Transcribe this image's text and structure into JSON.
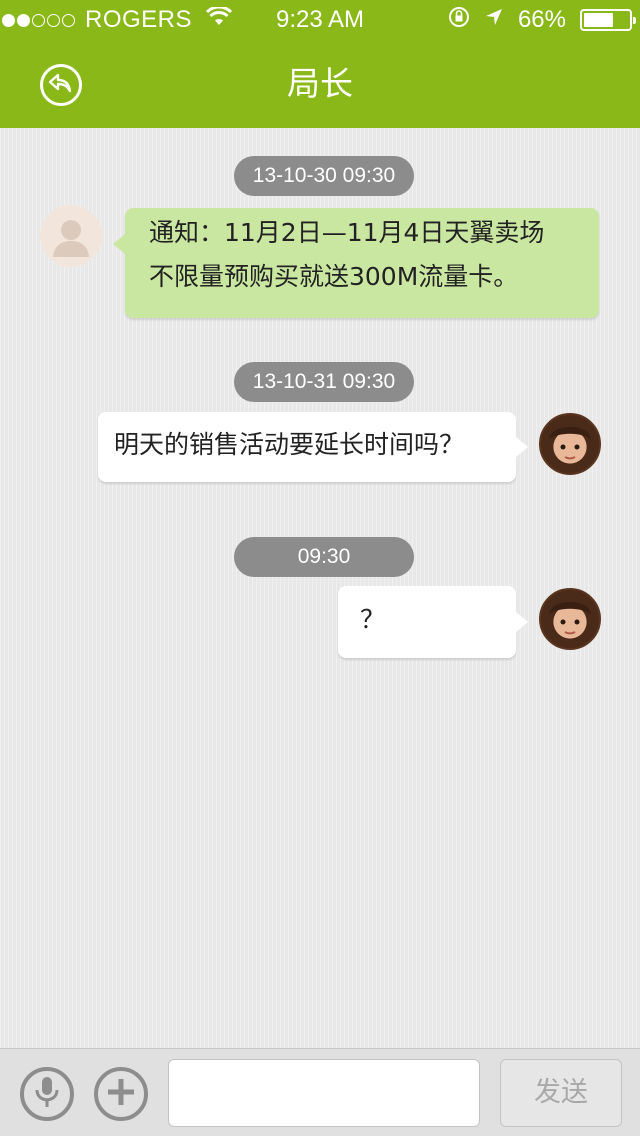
{
  "status_bar": {
    "carrier": "ROGERS",
    "time": "9:23 AM",
    "battery_text": "66%",
    "battery_level": 0.66,
    "signal_bars_filled": 2,
    "signal_bars_total": 5
  },
  "header": {
    "title": "局长",
    "back_icon": "back-arrow-circle-icon",
    "bar_color": "#8ab819"
  },
  "messages": [
    {
      "timestamp": "13-10-30 09:30",
      "side": "left",
      "avatar": "default-user-avatar",
      "lines": [
        "通知：11月2日—11月4日天翼卖场",
        "不限量预购买就送300M流量卡。"
      ]
    },
    {
      "timestamp": "13-10-31 09:30",
      "side": "right",
      "avatar": "user-photo-avatar",
      "lines": [
        "明天的销售活动要延长时间吗？"
      ]
    },
    {
      "timestamp": "09:30",
      "side": "right",
      "avatar": "user-photo-avatar",
      "lines": [
        "？"
      ]
    }
  ],
  "input_bar": {
    "voice_icon": "microphone-icon",
    "add_icon": "plus-icon",
    "input_value": "",
    "send_label": "发送"
  },
  "colors": {
    "accent": "#8ab819",
    "incoming_bubble": "#cae7a2",
    "outgoing_bubble": "#ffffff",
    "timestamp_pill": "#8c8c8c"
  }
}
